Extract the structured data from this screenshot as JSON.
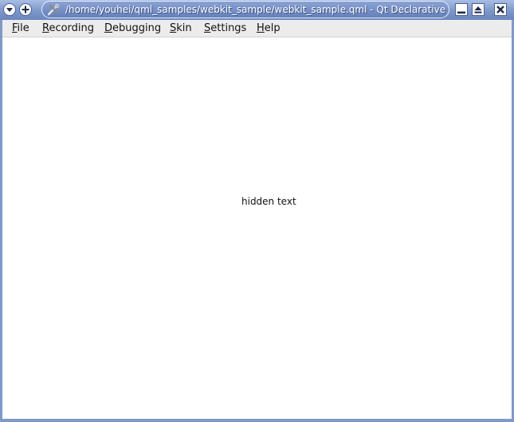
{
  "window": {
    "title": "/home/youhei/qml_samples/webkit_sample/webkit_sample.qml - Qt Declarative UI Vi",
    "app_icon": "qt-tools-icon",
    "controls": [
      "window-menu-icon",
      "sticky-icon",
      "minimize-icon",
      "shade-icon",
      "close-icon"
    ]
  },
  "menubar": {
    "items": [
      {
        "mnemonic": "F",
        "rest": "ile"
      },
      {
        "mnemonic": "R",
        "rest": "ecording"
      },
      {
        "mnemonic": "D",
        "rest": "ebugging"
      },
      {
        "mnemonic": "S",
        "rest": "kin"
      },
      {
        "mnemonic": "S",
        "rest": "ettings"
      },
      {
        "mnemonic": "H",
        "rest": "elp"
      }
    ]
  },
  "content": {
    "text": "hidden text"
  },
  "colors": {
    "titlebar": "#7d97c9",
    "menubar": "#ececec",
    "content": "#ffffff"
  }
}
